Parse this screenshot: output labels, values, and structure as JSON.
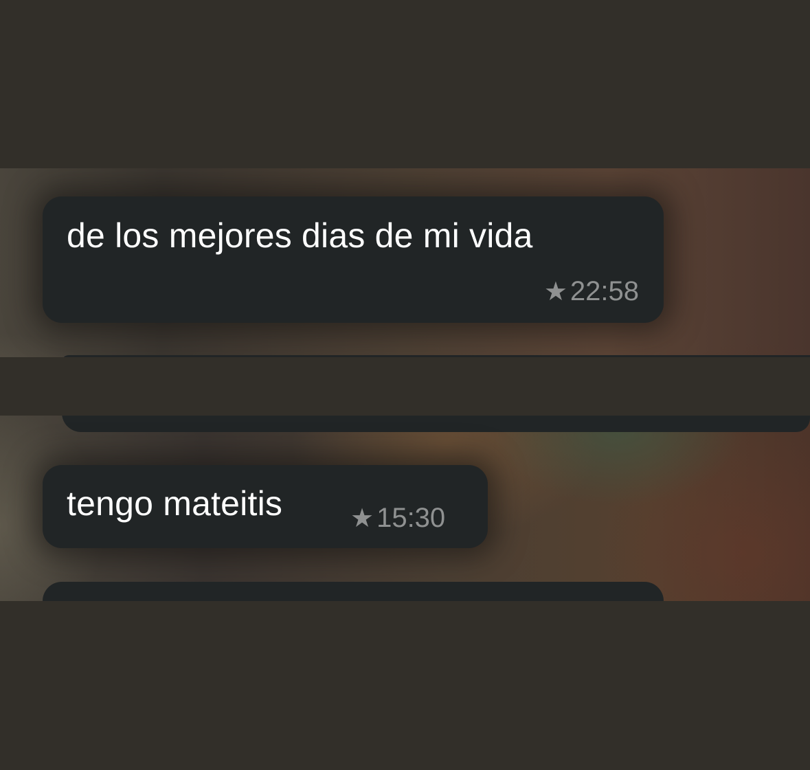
{
  "colors": {
    "background": "#322f29",
    "bubble": "#212526",
    "message_text": "#ffffff",
    "meta_text": "#8f9191"
  },
  "messages": [
    {
      "text": "de los mejores dias de mi vida",
      "starred": true,
      "star_icon": "star-icon",
      "time": "22:58"
    },
    {
      "text": "tengo mateitis",
      "starred": true,
      "star_icon": "star-icon",
      "time": "15:30"
    }
  ]
}
